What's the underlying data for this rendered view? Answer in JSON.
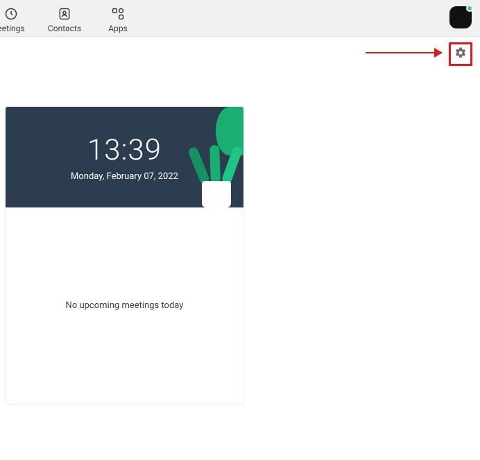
{
  "toolbar": {
    "tabs": [
      {
        "label": "eetings",
        "icon": "clock-icon"
      },
      {
        "label": "Contacts",
        "icon": "contact-icon"
      },
      {
        "label": "Apps",
        "icon": "apps-icon"
      }
    ]
  },
  "hero": {
    "time": "13:39",
    "date": "Monday, February 07, 2022"
  },
  "meetings": {
    "empty_message": "No upcoming meetings today"
  }
}
